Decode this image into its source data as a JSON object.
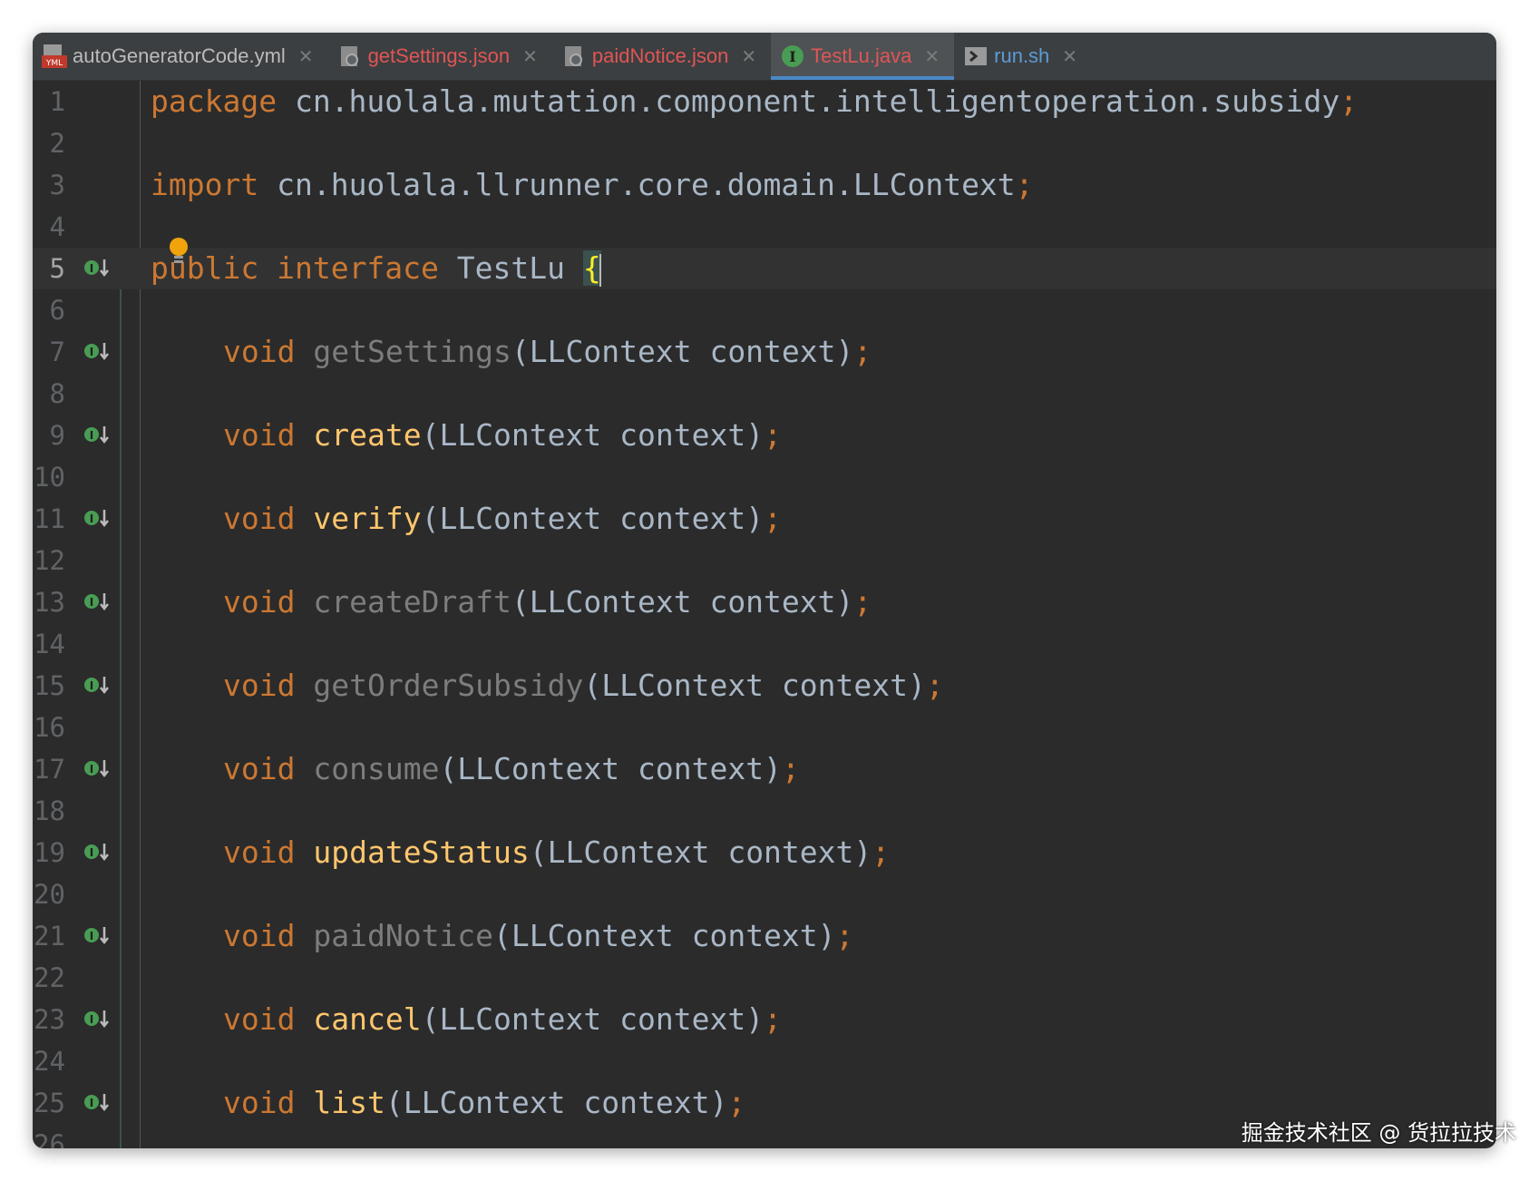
{
  "tabs": [
    {
      "label": "autoGeneratorCode.yml",
      "icon": "yml-file-icon",
      "color": "#bbbbbb",
      "active": false
    },
    {
      "label": "getSettings.json",
      "icon": "json-file-icon",
      "color": "#e05555",
      "active": false
    },
    {
      "label": "paidNotice.json",
      "icon": "json-file-icon",
      "color": "#e05555",
      "active": false
    },
    {
      "label": "TestLu.java",
      "icon": "interface-icon",
      "color": "#e05555",
      "active": true
    },
    {
      "label": "run.sh",
      "icon": "shell-script-icon",
      "color": "#5c9bd6",
      "active": false
    }
  ],
  "lines": [
    {
      "n": "1"
    },
    {
      "n": "2"
    },
    {
      "n": "3"
    },
    {
      "n": "4"
    },
    {
      "n": "5"
    },
    {
      "n": "6"
    },
    {
      "n": "7"
    },
    {
      "n": "8"
    },
    {
      "n": "9"
    },
    {
      "n": "10"
    },
    {
      "n": "11"
    },
    {
      "n": "12"
    },
    {
      "n": "13"
    },
    {
      "n": "14"
    },
    {
      "n": "15"
    },
    {
      "n": "16"
    },
    {
      "n": "17"
    },
    {
      "n": "18"
    },
    {
      "n": "19"
    },
    {
      "n": "20"
    },
    {
      "n": "21"
    },
    {
      "n": "22"
    },
    {
      "n": "23"
    },
    {
      "n": "24"
    },
    {
      "n": "25"
    },
    {
      "n": "26"
    }
  ],
  "code": {
    "package_kw": "package",
    "package_name": "cn.huolala.mutation.component.intelligentoperation.subsidy",
    "import_kw": "import",
    "import_name": "cn.huolala.llrunner.core.domain.LLContext",
    "public_kw": "public",
    "interface_kw": "interface",
    "interface_name": "TestLu",
    "open_brace": "{",
    "semicolon": ";",
    "void_kw": "void",
    "param": "(LLContext context)",
    "methods": [
      {
        "name": "getSettings",
        "used": false
      },
      {
        "name": "create",
        "used": true
      },
      {
        "name": "verify",
        "used": true
      },
      {
        "name": "createDraft",
        "used": false
      },
      {
        "name": "getOrderSubsidy",
        "used": false
      },
      {
        "name": "consume",
        "used": false
      },
      {
        "name": "updateStatus",
        "used": true
      },
      {
        "name": "paidNotice",
        "used": false
      },
      {
        "name": "cancel",
        "used": true
      },
      {
        "name": "list",
        "used": true
      }
    ]
  },
  "gutter_icon": "implemented-method-icon",
  "intention_icon": "lightbulb-icon",
  "watermark": "掘金技术社区 @ 货拉拉技术",
  "colors": {
    "keyword": "#cc7832",
    "method_declared": "#ffc66d",
    "unused": "#7d7d7d",
    "text": "#a9b7c6",
    "background": "#2b2b2b",
    "active_tab_underline": "#4a88c7"
  }
}
